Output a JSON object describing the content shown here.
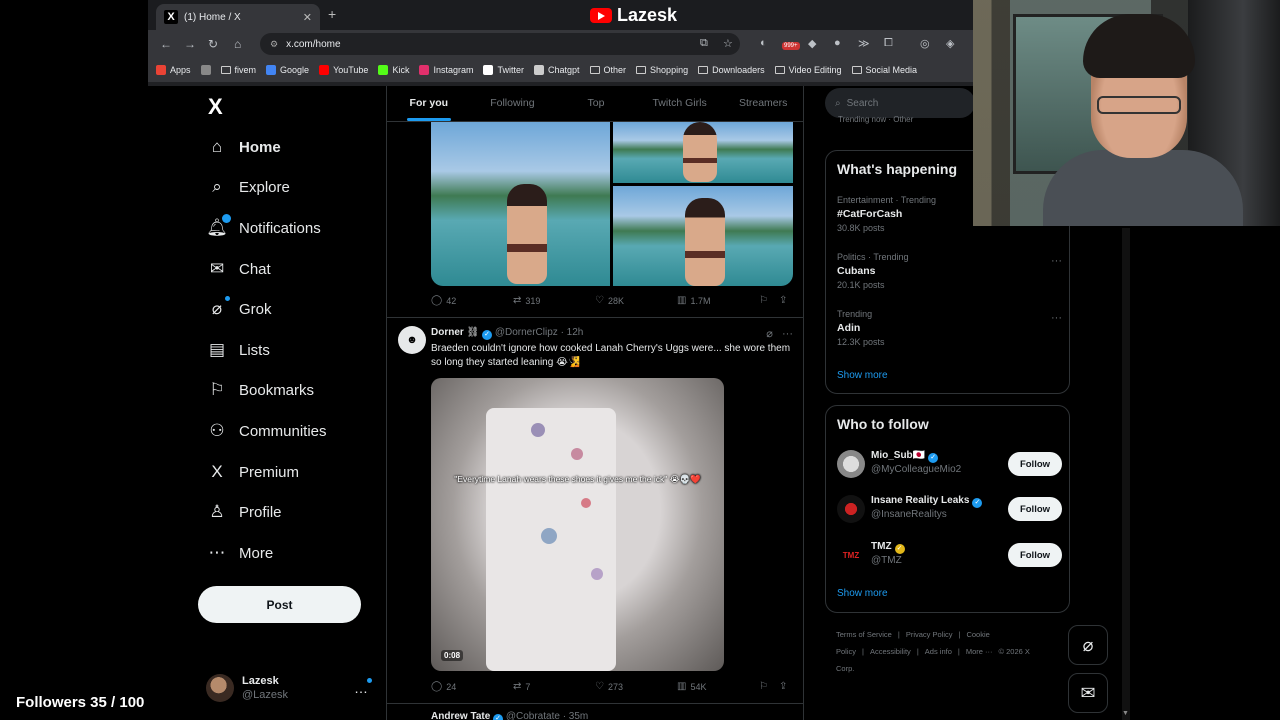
{
  "browser": {
    "tab_title": "(1) Home / X",
    "tab_close": "✕",
    "new_tab": "+",
    "brand": "Lazesk",
    "url": "x.com/home",
    "ext_badge": "999+",
    "bookmarks": [
      {
        "label": "Apps",
        "icon": "apps-grid-icon",
        "color": "#ea4335"
      },
      {
        "label": "",
        "icon": "grid-icon",
        "color": "#888888"
      },
      {
        "label": "fivem",
        "icon": "folder-icon",
        "color": "#cccccc"
      },
      {
        "label": "Google",
        "icon": "google-icon",
        "color": "#4285f4"
      },
      {
        "label": "YouTube",
        "icon": "youtube-icon",
        "color": "#ff0000"
      },
      {
        "label": "Kick",
        "icon": "kick-icon",
        "color": "#53fc18"
      },
      {
        "label": "Instagram",
        "icon": "instagram-icon",
        "color": "#e1306c"
      },
      {
        "label": "Twitter",
        "icon": "x-icon",
        "color": "#ffffff"
      },
      {
        "label": "Chatgpt",
        "icon": "chatgpt-icon",
        "color": "#cccccc"
      },
      {
        "label": "Other",
        "icon": "folder-icon",
        "color": "#cccccc"
      },
      {
        "label": "Shopping",
        "icon": "folder-icon",
        "color": "#cccccc"
      },
      {
        "label": "Downloaders",
        "icon": "folder-icon",
        "color": "#cccccc"
      },
      {
        "label": "Video Editing",
        "icon": "folder-icon",
        "color": "#cccccc"
      },
      {
        "label": "Social Media",
        "icon": "folder-icon",
        "color": "#cccccc"
      }
    ]
  },
  "nav": {
    "logo": "X",
    "items": [
      {
        "label": "Home",
        "icon": "home-icon",
        "glyph": "⌂"
      },
      {
        "label": "Explore",
        "icon": "search-icon",
        "glyph": "⌕"
      },
      {
        "label": "Notifications",
        "icon": "bell-icon",
        "glyph": "🔔︎"
      },
      {
        "label": "Chat",
        "icon": "mail-icon",
        "glyph": "✉"
      },
      {
        "label": "Grok",
        "icon": "grok-icon",
        "glyph": "⌀"
      },
      {
        "label": "Lists",
        "icon": "list-icon",
        "glyph": "▤"
      },
      {
        "label": "Bookmarks",
        "icon": "bookmark-icon",
        "glyph": "⚐"
      },
      {
        "label": "Communities",
        "icon": "communities-icon",
        "glyph": "⚇"
      },
      {
        "label": "Premium",
        "icon": "x-premium-icon",
        "glyph": "X"
      },
      {
        "label": "Profile",
        "icon": "profile-icon",
        "glyph": "♙"
      },
      {
        "label": "More",
        "icon": "more-circle-icon",
        "glyph": "⋯"
      }
    ],
    "post_label": "Post",
    "account_name": "Lazesk",
    "account_handle": "@Lazesk",
    "account_more": "…"
  },
  "overlay": {
    "followers": "Followers 35 / 100"
  },
  "feed": {
    "tabs": [
      "For you",
      "Following",
      "Top",
      "Twitch Girls",
      "Streamers"
    ],
    "post1_stats": {
      "replies": "42",
      "reposts": "319",
      "likes": "28K",
      "views": "1.7M"
    },
    "post2": {
      "name": "Dorner",
      "handle": "@DornerClipz",
      "time": "· 12h",
      "text": "Braeden couldn't ignore how cooked Lanah Cherry's Uggs were... she wore them so long they started leaning 😭🧏",
      "caption": "\"Everytime Lanah wears these shoes it gives me the ick\" 😭💀❤️",
      "duration": "0:08",
      "replies": "24",
      "reposts": "7",
      "likes": "273",
      "views": "54K"
    },
    "post3": {
      "name": "Andrew Tate",
      "handle": "@Cobratate · 35m"
    }
  },
  "sidebar": {
    "search_placeholder": "Search",
    "partial_trend": "Trending now · Other",
    "happening_title": "What's happening",
    "trends": [
      {
        "category": "Entertainment · Trending",
        "name": "#CatForCash",
        "count": "30.8K posts"
      },
      {
        "category": "Politics · Trending",
        "name": "Cubans",
        "count": "20.1K posts"
      },
      {
        "category": "Trending",
        "name": "Adin",
        "count": "12.3K posts"
      }
    ],
    "show_more": "Show more",
    "who_title": "Who to follow",
    "who": [
      {
        "name": "Mio_Sub🇯🇵",
        "handle": "@MyColleagueMio2",
        "badge": "blue"
      },
      {
        "name": "Insane Reality Leaks",
        "handle": "@InsaneRealitys",
        "badge": "blue"
      },
      {
        "name": "TMZ",
        "handle": "@TMZ",
        "badge": "gold"
      }
    ],
    "follow_label": "Follow",
    "footer": [
      "Terms of Service",
      "|",
      "Privacy Policy",
      "|",
      "Cookie Policy",
      "|",
      "Accessibility",
      "|",
      "Ads info",
      "|",
      "More ···",
      "© 2026 X Corp."
    ]
  }
}
